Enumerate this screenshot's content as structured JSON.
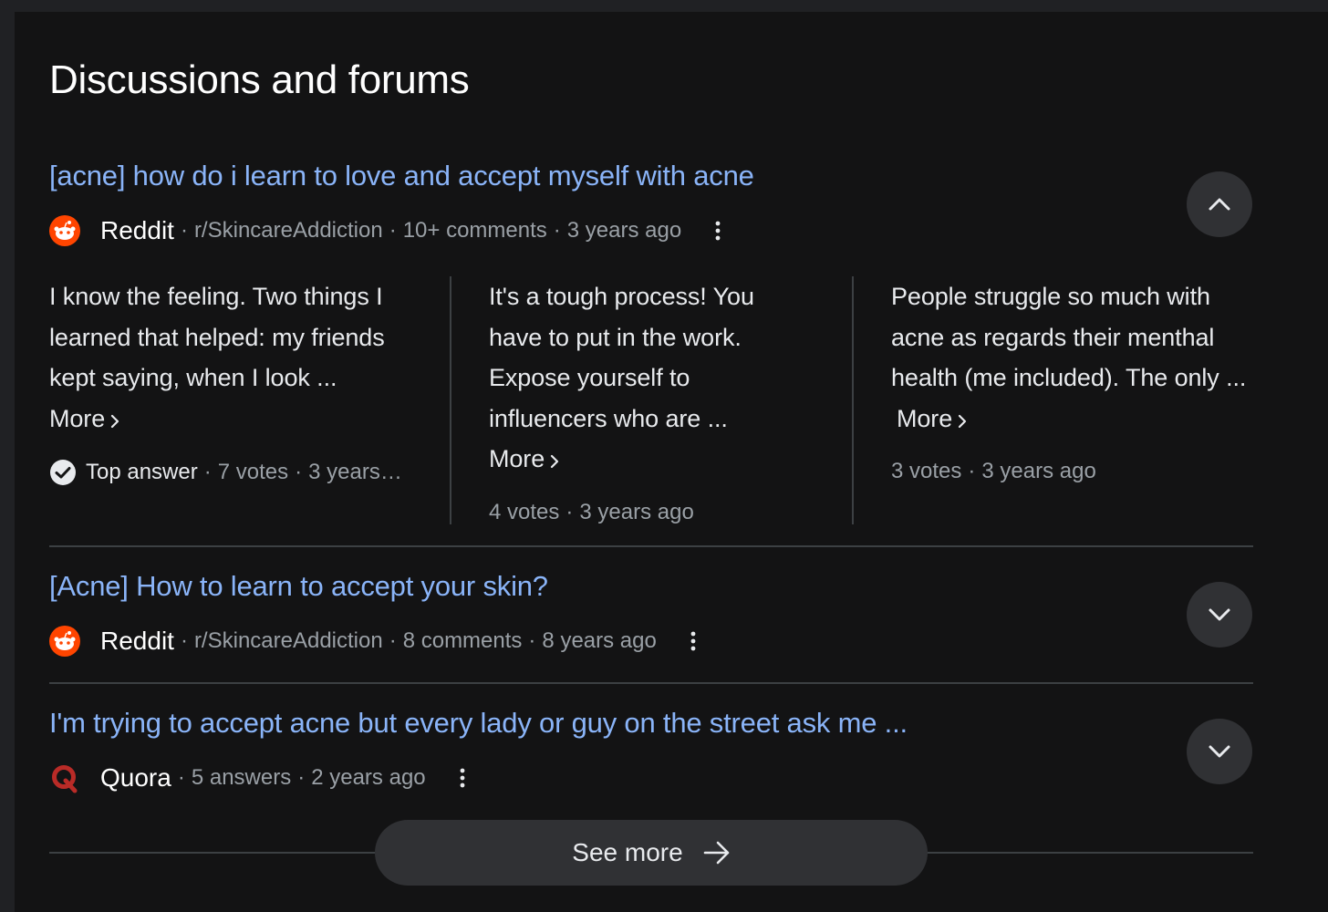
{
  "section": {
    "title": "Discussions and forums"
  },
  "results": [
    {
      "title": "[acne] how do i learn to love and accept myself with acne",
      "site": "Reddit",
      "meta": [
        "r/SkincareAddiction",
        "10+ comments",
        "3 years ago"
      ],
      "expanded": true,
      "answers": [
        {
          "text": "I know the feeling. Two things I learned that helped: my friends kept saying, when I look ...",
          "more_label": "More",
          "badge": "Top answer",
          "meta": [
            "7 votes",
            "3 years…"
          ]
        },
        {
          "text": "It's a tough process! You have to put in the work. Expose yourself to influencers who are ...",
          "more_label": "More",
          "meta": [
            "4 votes",
            "3 years ago"
          ]
        },
        {
          "text": "People struggle so much with acne as regards their menthal health (me included). The only ...",
          "more_label": "More",
          "meta": [
            "3 votes",
            "3 years ago"
          ]
        }
      ]
    },
    {
      "title": "[Acne] How to learn to accept your skin?",
      "site": "Reddit",
      "meta": [
        "r/SkincareAddiction",
        "8 comments",
        "8 years ago"
      ],
      "expanded": false
    },
    {
      "title": "I'm trying to accept acne but every lady or guy on the street ask me ...",
      "site": "Quora",
      "meta": [
        "5 answers",
        "2 years ago"
      ],
      "expanded": false
    }
  ],
  "see_more_label": "See more",
  "colors": {
    "background": "#131314",
    "link": "#8ab4f8",
    "reddit": "#ff4500",
    "quora": "#b92b27",
    "muted": "#9aa0a6"
  },
  "icons": [
    "reddit-logo-icon",
    "quora-logo-icon",
    "more-vert-icon",
    "chevron-up-icon",
    "chevron-down-icon",
    "chevron-right-icon",
    "check-circle-icon",
    "arrow-right-icon"
  ]
}
